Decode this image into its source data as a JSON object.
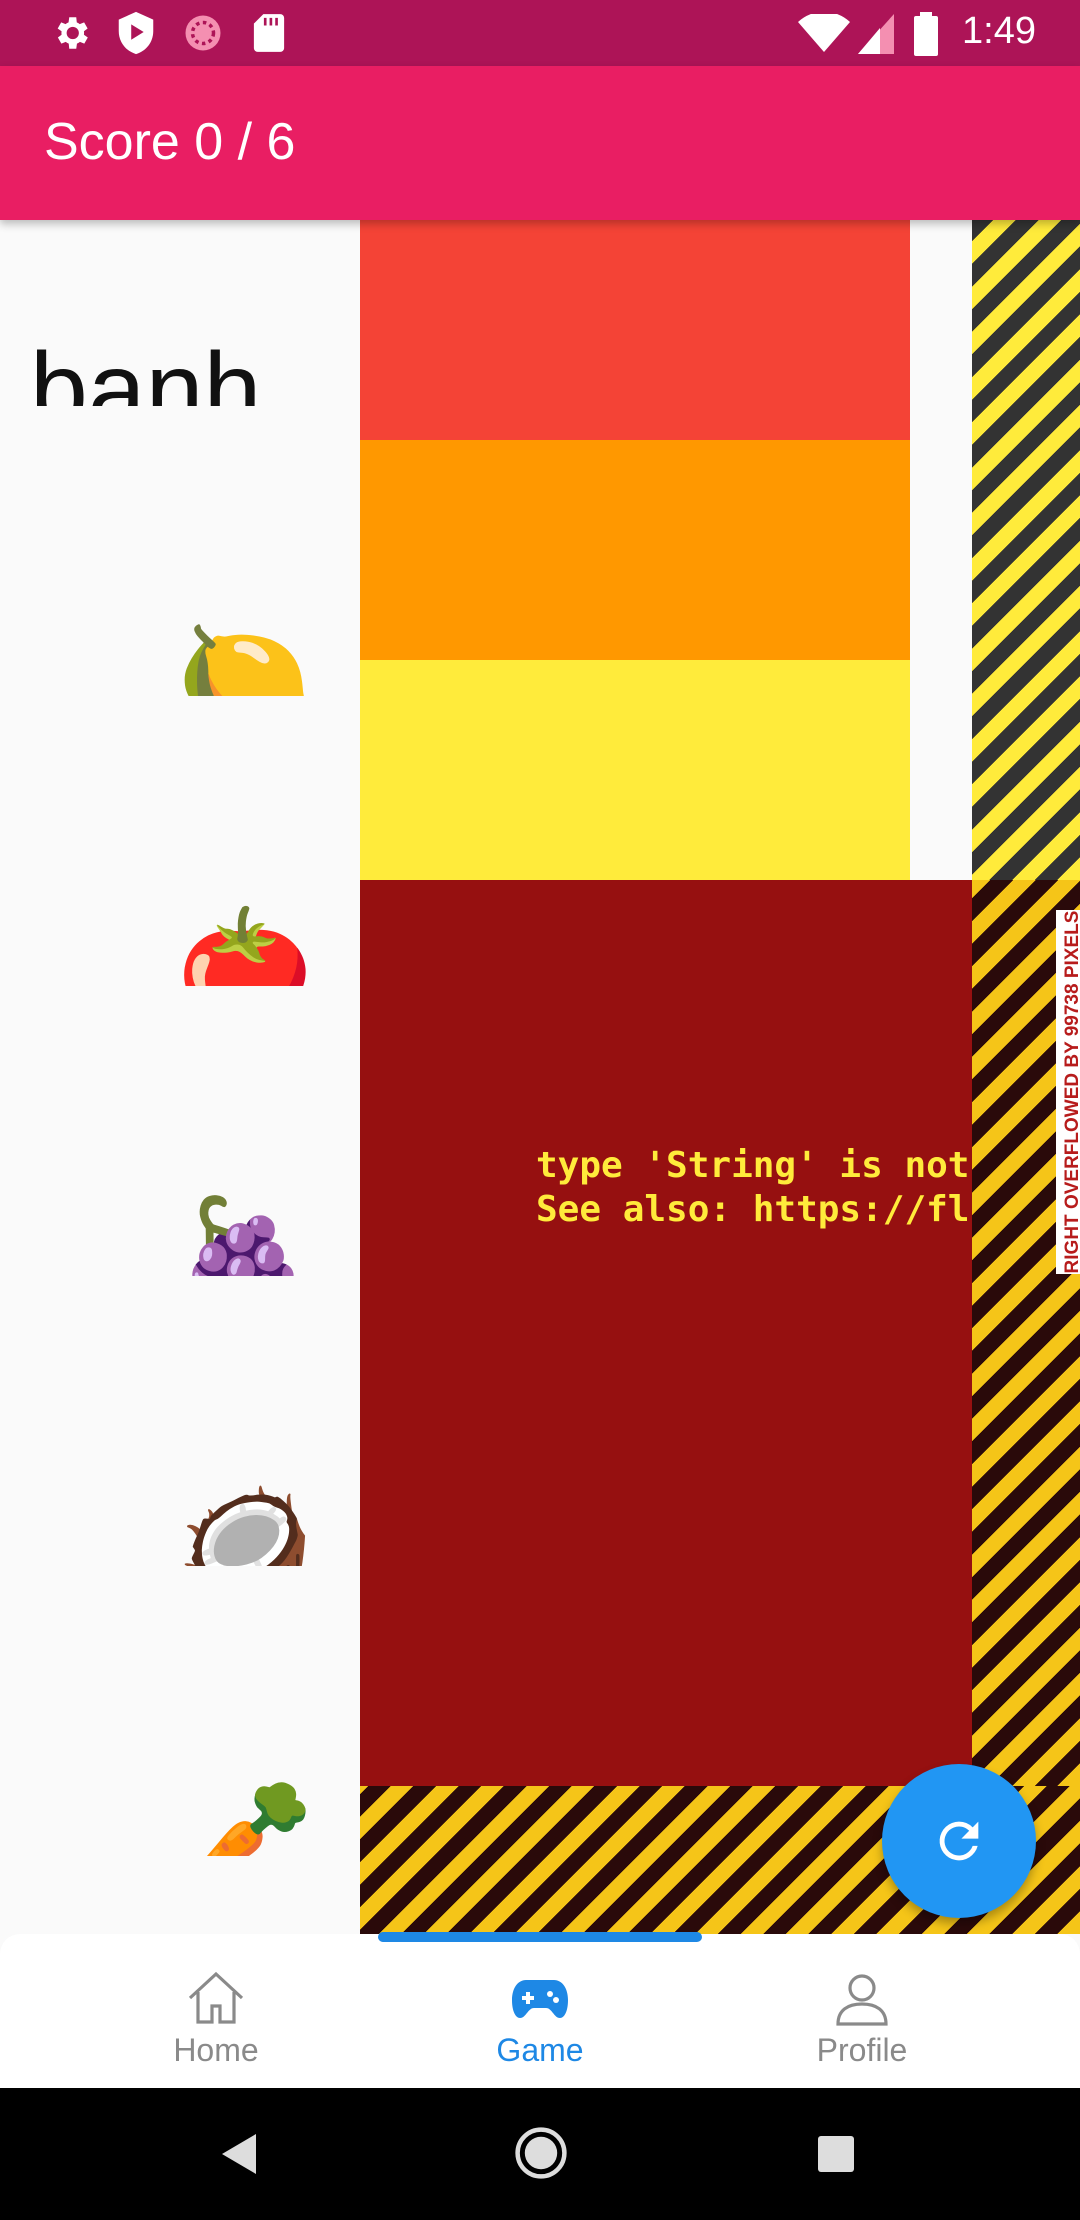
{
  "status_bar": {
    "time": "1:49",
    "icons": [
      "settings-icon",
      "shield-play-icon",
      "pie-icon",
      "sd-card-icon",
      "wifi-icon",
      "signal-icon",
      "battery-icon"
    ]
  },
  "app_bar": {
    "title": "Score 0 / 6"
  },
  "word": "banh",
  "emojis": [
    {
      "name": "lemon",
      "glyph": "🍋"
    },
    {
      "name": "tomato",
      "glyph": "🍅"
    },
    {
      "name": "grapes",
      "glyph": "🍇"
    },
    {
      "name": "coconut",
      "glyph": "🥥"
    },
    {
      "name": "carrot",
      "glyph": "🥕"
    }
  ],
  "color_blocks": [
    {
      "name": "red",
      "color": "#f44336"
    },
    {
      "name": "orange",
      "color": "#ff9800"
    },
    {
      "name": "yellow",
      "color": "#ffeb3b"
    }
  ],
  "error": {
    "background": "#961010",
    "line1": "type 'String' is not a",
    "line2": "See also: https://flutt"
  },
  "overflow_label": "RIGHT OVERFLOWED BY 99738 PIXELS",
  "fab": {
    "icon": "refresh-icon",
    "color": "#2196f3"
  },
  "bottom_nav": {
    "items": [
      {
        "label": "Home",
        "icon": "home-icon",
        "active": false
      },
      {
        "label": "Game",
        "icon": "gamepad-icon",
        "active": true
      },
      {
        "label": "Profile",
        "icon": "profile-icon",
        "active": false
      }
    ],
    "active_color": "#1e88e5",
    "inactive_color": "#8a8a8a"
  },
  "system_nav": [
    "back-icon",
    "home-circle-icon",
    "recents-icon"
  ]
}
